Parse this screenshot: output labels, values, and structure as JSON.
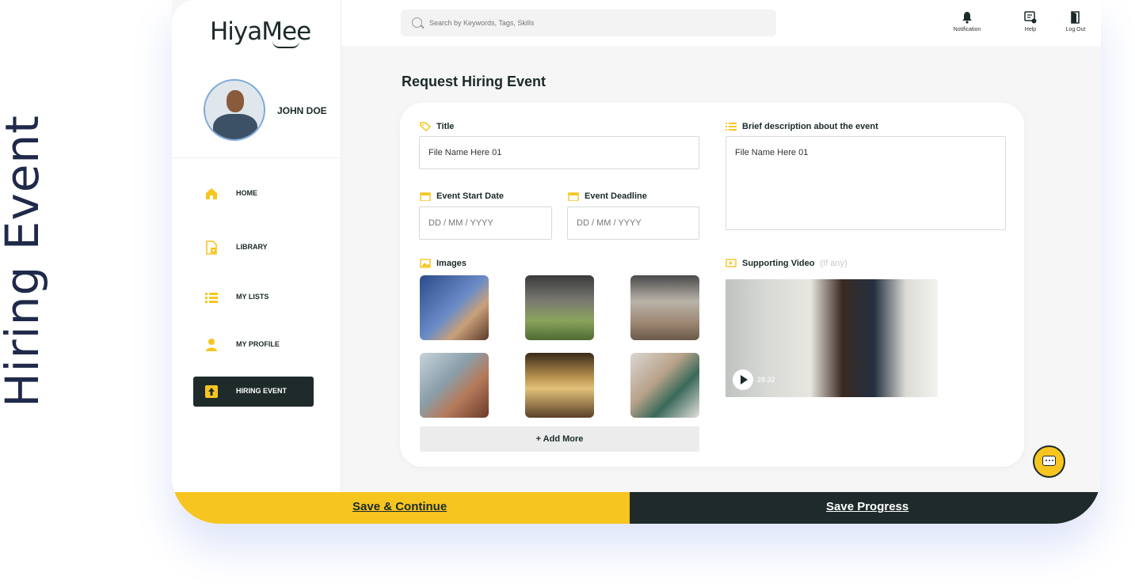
{
  "side_title": "Hiring Event",
  "brand": {
    "logo_text": "HiyaMee"
  },
  "user": {
    "name": "JOHN DOE"
  },
  "sidebar": {
    "items": [
      {
        "label": "HOME",
        "icon": "home-icon"
      },
      {
        "label": "LIBRARY",
        "icon": "library-icon"
      },
      {
        "label": "MY LISTS",
        "icon": "list-icon"
      },
      {
        "label": "MY PROFILE",
        "icon": "user-icon"
      },
      {
        "label": "HIRING EVENT",
        "icon": "upload-icon",
        "active": true
      }
    ]
  },
  "header": {
    "search_placeholder": "Search by Keywords, Tags, Skills",
    "actions": [
      {
        "label": "Notification",
        "icon": "bell-icon"
      },
      {
        "label": "Help",
        "icon": "help-icon"
      },
      {
        "label": "Log Out",
        "icon": "logout-icon"
      }
    ]
  },
  "main": {
    "title": "Request Hiring Event",
    "form": {
      "title_label": "Title",
      "title_value": "File Name Here 01",
      "description_label": "Brief description about the event",
      "description_value": "File Name Here 01",
      "start_date_label": "Event Start Date",
      "start_date_placeholder": "DD / MM / YYYY",
      "deadline_label": "Event Deadline",
      "deadline_placeholder": "DD / MM / YYYY",
      "images_label": "Images",
      "add_more_label": "+ Add More",
      "video_label": "Supporting Video",
      "video_note": "(If any)",
      "video_duration": "28:32"
    }
  },
  "footer": {
    "save_continue_label": "Save & Continue",
    "save_progress_label": "Save Progress"
  },
  "colors": {
    "accent": "#f7c520",
    "dark": "#1f2b2a",
    "background": "#f6f6f6"
  }
}
